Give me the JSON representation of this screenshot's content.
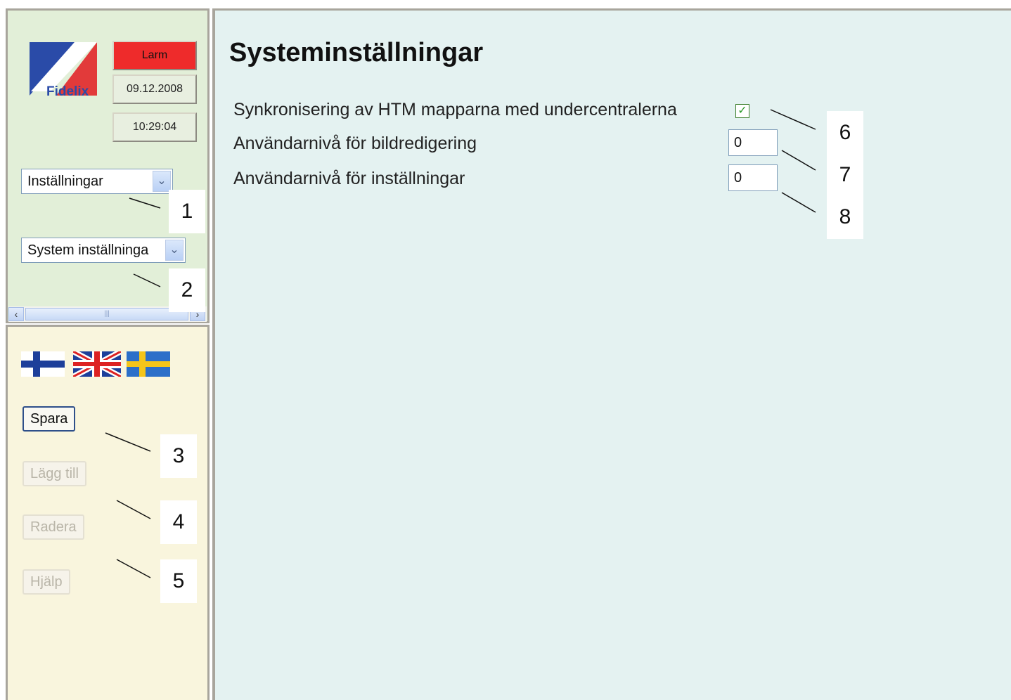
{
  "brand": {
    "logo_text": "Fidelix"
  },
  "status": {
    "alarm_label": "Larm",
    "alarm_color": "#ee2b2b",
    "date": "09.12.2008",
    "time": "10:29:04"
  },
  "nav": {
    "category_select": {
      "selected": "Inställningar"
    },
    "page_select": {
      "selected": "System inställninga"
    }
  },
  "languages": [
    {
      "name": "finnish-flag-icon"
    },
    {
      "name": "uk-flag-icon"
    },
    {
      "name": "swedish-flag-icon"
    }
  ],
  "actions": {
    "save_label": "Spara",
    "add_label": "Lägg till",
    "delete_label": "Radera",
    "help_label": "Hjälp"
  },
  "page": {
    "title": "Systeminställningar",
    "settings": [
      {
        "label": "Synkronisering av HTM mapparna med undercentralerna",
        "type": "checkbox",
        "checked": true
      },
      {
        "label": "Användarnivå för bildredigering",
        "type": "number",
        "value": "0"
      },
      {
        "label": "Användarnivå för inställningar",
        "type": "number",
        "value": "0"
      }
    ]
  },
  "callouts": [
    "1",
    "2",
    "3",
    "4",
    "5",
    "6",
    "7",
    "8"
  ],
  "colors": {
    "left_top_bg": "#e2efd8",
    "left_bottom_bg": "#f9f5dd",
    "main_bg": "#e4f2f1",
    "frame": "#a8a59c"
  }
}
